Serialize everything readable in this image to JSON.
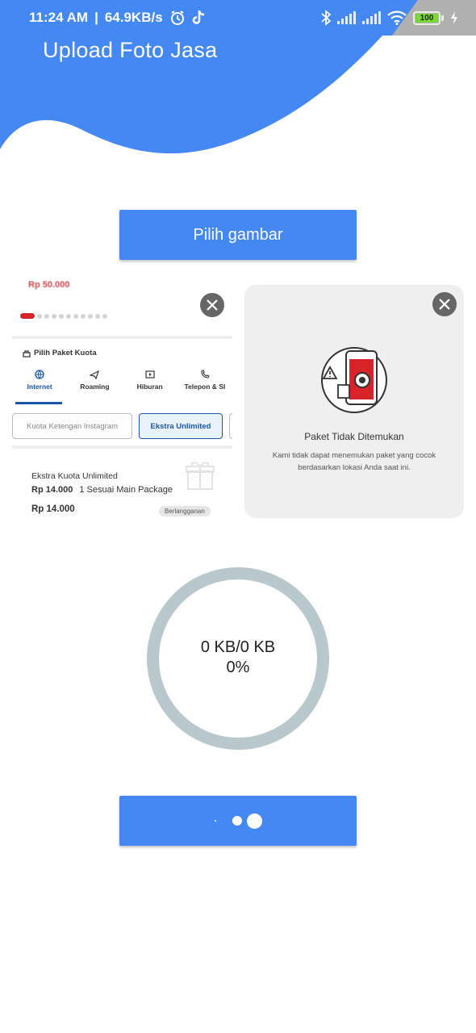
{
  "status_bar": {
    "time": "11:24 AM",
    "network_speed": "64.9KB/s",
    "battery_level": "100",
    "icons": [
      "alarm-icon",
      "tiktok-icon",
      "bluetooth-icon",
      "signal-icon",
      "signal-icon",
      "wifi-icon",
      "battery-icon",
      "charging-icon"
    ]
  },
  "header": {
    "title": "Upload Foto Jasa",
    "color": "#4488f4"
  },
  "pick_button": {
    "label": "Pilih gambar"
  },
  "images": [
    {
      "top_price": "Rp 50.000",
      "section_title": "Pilih Paket Kuota",
      "tabs": [
        "Internet",
        "Roaming",
        "Hiburan",
        "Telepon & SI"
      ],
      "chips": [
        "Kuota Ketengan Instagram",
        "Ekstra Unlimited"
      ],
      "card": {
        "name": "Ekstra Kuota Unlimited",
        "price": "Rp 14.000",
        "desc": "1 Sesuai Main Package",
        "total": "Rp 14.000",
        "badge": "Berlangganan"
      }
    },
    {
      "title": "Paket Tidak Ditemukan",
      "description": "Kami tidak dapat menemukan paket yang cocok berdasarkan lokasi Anda saat ini."
    }
  ],
  "progress": {
    "size_text": "0 KB/0 KB",
    "percent_text": "0%",
    "percent": 0,
    "ring_color": "#b9c8cc"
  },
  "upload_button": {
    "state": "loading"
  }
}
